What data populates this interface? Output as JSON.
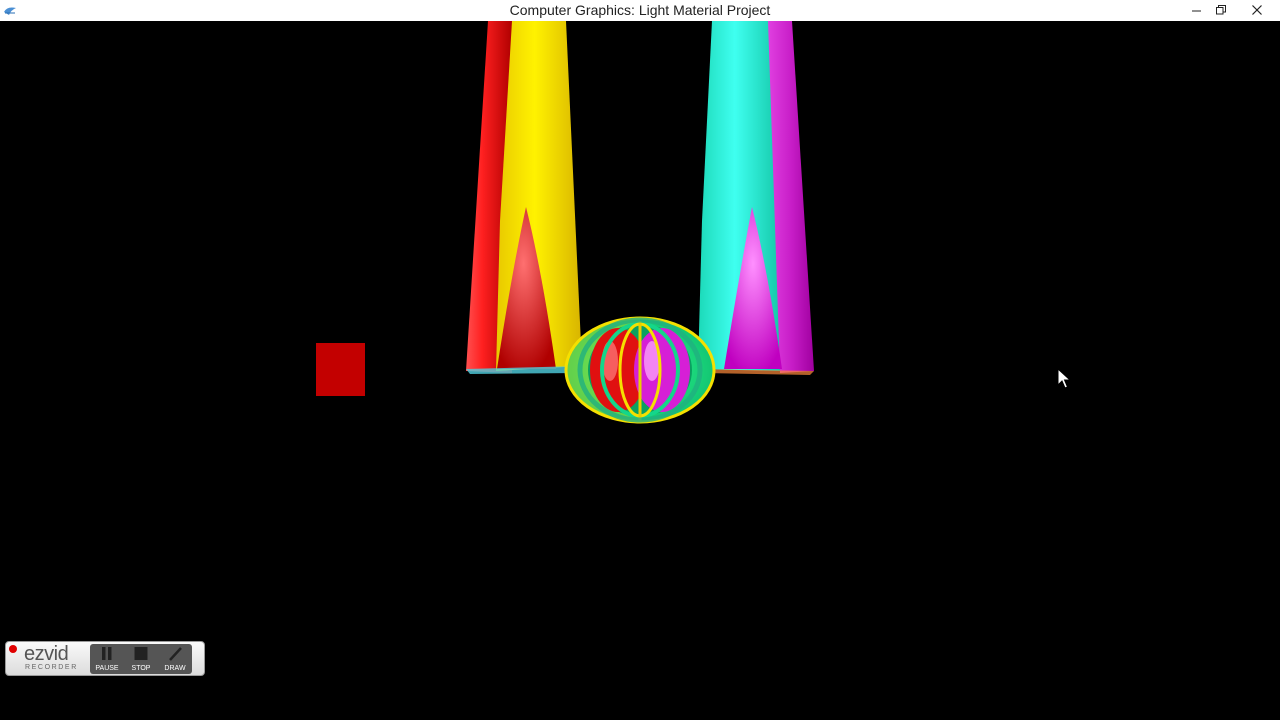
{
  "window": {
    "title": "Computer Graphics: Light Material Project",
    "controls": {
      "minimize_icon": "minimize-icon",
      "restore_icon": "restore-icon",
      "close_icon": "close-icon"
    }
  },
  "scene": {
    "background": "#000000",
    "objects": [
      {
        "name": "cone-left-red",
        "color": "#e01010"
      },
      {
        "name": "cone-left-yellow",
        "color": "#f5e000"
      },
      {
        "name": "cone-right-cyan",
        "color": "#1ff5d2"
      },
      {
        "name": "cone-right-magenta",
        "color": "#d61fd6"
      },
      {
        "name": "torus-center",
        "colors": [
          "#19e58c",
          "#e01010",
          "#f5e000",
          "#d61fd6"
        ]
      },
      {
        "name": "red-square",
        "color": "#c30000"
      }
    ]
  },
  "recorder": {
    "logo": "ezvid",
    "logo_sub": "RECORDER",
    "buttons": [
      {
        "label": "PAUSE",
        "icon": "pause-icon"
      },
      {
        "label": "STOP",
        "icon": "stop-icon"
      },
      {
        "label": "DRAW",
        "icon": "pencil-icon"
      }
    ]
  }
}
